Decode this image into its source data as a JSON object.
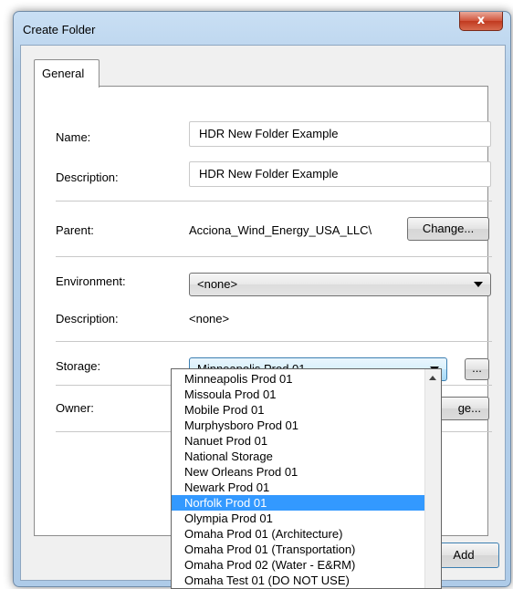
{
  "window": {
    "title": "Create Folder",
    "close_glyph": "x"
  },
  "tabs": [
    {
      "label": "General"
    }
  ],
  "form": {
    "name_label": "Name:",
    "name_value": "HDR New Folder Example",
    "description_label": "Description:",
    "description_value": "HDR New Folder Example",
    "parent_label": "Parent:",
    "parent_value": "Acciona_Wind_Energy_USA_LLC\\",
    "change_label": "Change...",
    "environment_label": "Environment:",
    "environment_value": "<none>",
    "env_description_label": "Description:",
    "env_description_value": "<none>",
    "storage_label": "Storage:",
    "storage_value": "Minneapolis Prod 01",
    "storage_more_label": "...",
    "owner_label": "Owner:",
    "owner_change_partial": "ge..."
  },
  "footer": {
    "add_label": "Add"
  },
  "storage_options": [
    "Minneapolis Prod 01",
    "Missoula Prod 01",
    "Mobile Prod 01",
    "Murphysboro Prod 01",
    "Nanuet Prod 01",
    "National Storage",
    "New Orleans Prod 01",
    "Newark Prod 01",
    "Norfolk Prod 01",
    "Olympia Prod 01",
    "Omaha Prod 01 (Architecture)",
    "Omaha Prod 01 (Transportation)",
    "Omaha Prod 02 (Water - E&RM)",
    "Omaha Test 01 (DO NOT USE)"
  ],
  "storage_highlighted_index": 8,
  "colors": {
    "selection": "#3399ff",
    "title_bar": "#b9d3ec"
  }
}
